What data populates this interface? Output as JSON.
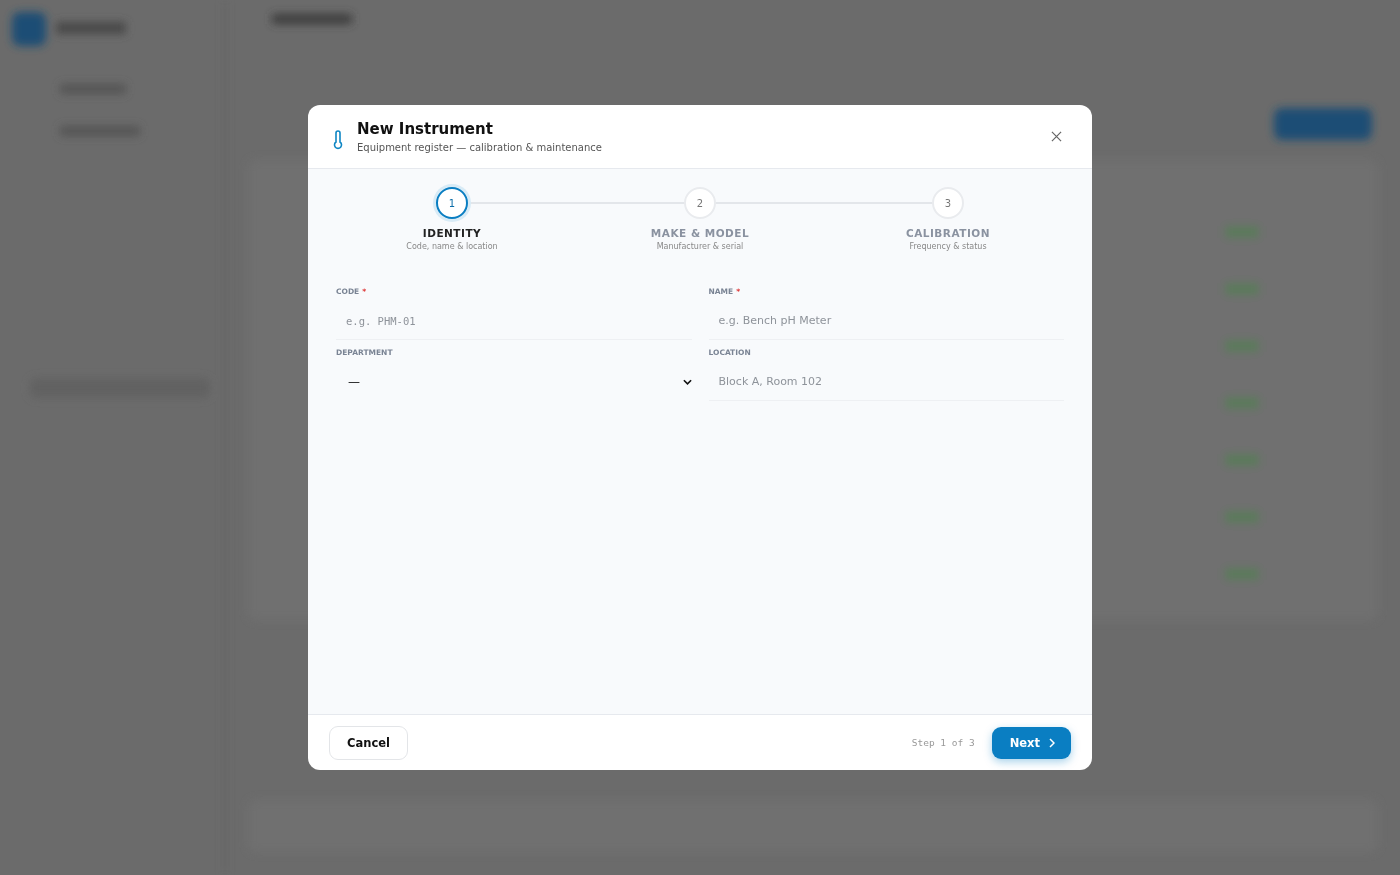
{
  "dialog": {
    "title": "New Instrument",
    "subtitle": "Equipment register — calibration & maintenance",
    "steps": [
      {
        "number": "1",
        "label": "IDENTITY",
        "hint": "Code, name & location",
        "selected": true
      },
      {
        "number": "2",
        "label": "MAKE & MODEL",
        "hint": "Manufacturer & serial",
        "selected": false
      },
      {
        "number": "3",
        "label": "CALIBRATION",
        "hint": "Frequency & status",
        "selected": false
      }
    ],
    "fields": [
      {
        "kind": "text",
        "label": "CODE",
        "required_mark": "*",
        "placeholder": "e.g. PHM-01",
        "mono": true
      },
      {
        "kind": "text",
        "label": "NAME",
        "required_mark": "*",
        "placeholder": "e.g. Bench pH Meter",
        "mono": false
      },
      {
        "kind": "select",
        "label": "DEPARTMENT",
        "value": "—"
      },
      {
        "kind": "text",
        "label": "LOCATION",
        "placeholder": "Block A, Room 102",
        "mono": false
      }
    ],
    "footer": {
      "cancel": "Cancel",
      "step_text": "Step 1 of 3",
      "next": "Next"
    }
  }
}
